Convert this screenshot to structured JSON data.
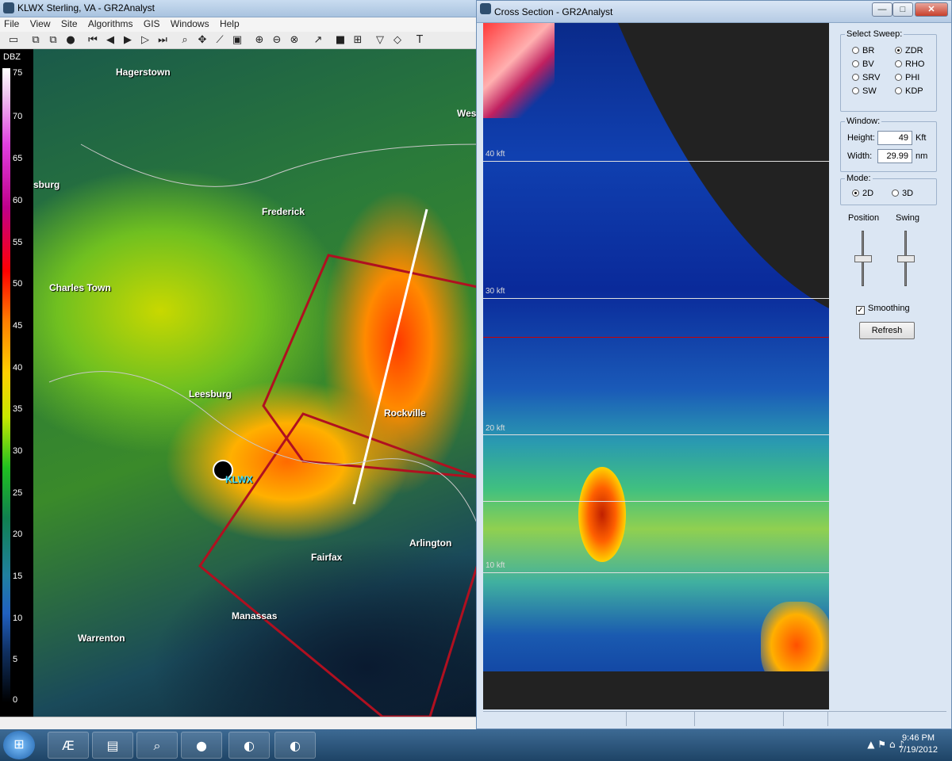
{
  "main_window": {
    "title": "KLWX Sterling, VA - GR2Analyst",
    "menu": [
      "File",
      "View",
      "Site",
      "Algorithms",
      "GIS",
      "Windows",
      "Help"
    ],
    "legend": {
      "unit": "DBZ",
      "ticks": [
        "75",
        "70",
        "65",
        "60",
        "55",
        "50",
        "45",
        "40",
        "35",
        "30",
        "25",
        "20",
        "15",
        "10",
        "5",
        "0"
      ]
    },
    "map_labels": {
      "hagerstown": "Hagerstown",
      "frederick": "Frederick",
      "charles_town": "Charles Town",
      "leesburg": "Leesburg",
      "rockville": "Rockville",
      "fairfax": "Fairfax",
      "arlington": "Arlington",
      "manassas": "Manassas",
      "warrenton": "Warrenton",
      "west": "Wes",
      "burg": "sburg",
      "station": "KLWX"
    }
  },
  "cross_section": {
    "title": "Cross Section - GR2Analyst",
    "window_buttons": {
      "minimize": "—",
      "maximize": "□",
      "close": "✕"
    },
    "height_labels": [
      "40 kft",
      "30 kft",
      "20 kft",
      "10 kft"
    ],
    "select_sweep": {
      "caption": "Select Sweep:",
      "options": [
        {
          "label": "BR",
          "selected": false
        },
        {
          "label": "ZDR",
          "selected": true
        },
        {
          "label": "BV",
          "selected": false
        },
        {
          "label": "RHO",
          "selected": false
        },
        {
          "label": "SRV",
          "selected": false
        },
        {
          "label": "PHI",
          "selected": false
        },
        {
          "label": "SW",
          "selected": false
        },
        {
          "label": "KDP",
          "selected": false
        }
      ]
    },
    "window_group": {
      "caption": "Window:",
      "height_label": "Height:",
      "height_value": "49",
      "height_unit": "Kft",
      "width_label": "Width:",
      "width_value": "29.99",
      "width_unit": "nm"
    },
    "mode": {
      "caption": "Mode:",
      "options": [
        {
          "label": "2D",
          "selected": true
        },
        {
          "label": "3D",
          "selected": false
        }
      ]
    },
    "sliders": {
      "position_label": "Position",
      "swing_label": "Swing"
    },
    "smoothing": {
      "label": "Smoothing",
      "checked": true
    },
    "refresh_label": "Refresh"
  },
  "taskbar": {
    "time": "9:46 PM",
    "date": "7/19/2012"
  }
}
